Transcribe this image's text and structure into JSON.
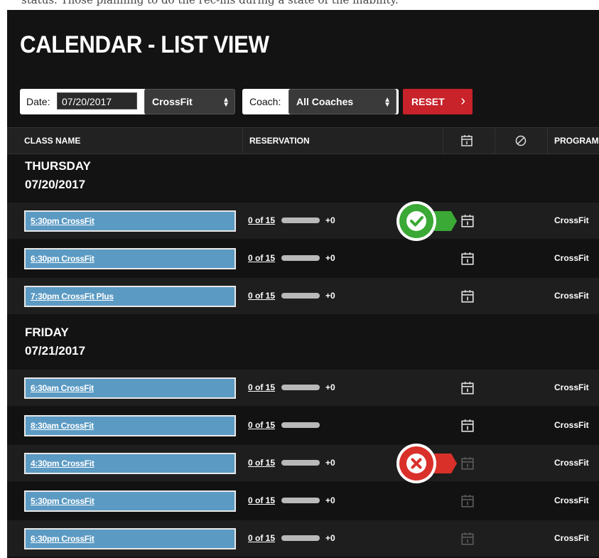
{
  "page": {
    "title": "CALENDAR - LIST VIEW",
    "top_caption": "status. Those planning to do the rec-ins during a state of the inability."
  },
  "filters": {
    "date_label": "Date:",
    "date_value": "07/20/2017",
    "program_value": "CrossFit",
    "coach_label": "Coach:",
    "coach_value": "All Coaches",
    "reset_label": "RESET"
  },
  "table": {
    "headers": {
      "class_name": "CLASS NAME",
      "reservation": "RESERVATION",
      "calendar_icon": "calendar-icon",
      "cancel_icon": "cancel-icon",
      "program": "PROGRAM"
    }
  },
  "days": [
    {
      "day": "THURSDAY",
      "date": "07/20/2017",
      "rows": [
        {
          "class": "5:30pm CrossFit",
          "reservation": "0 of 15",
          "waitlist": "+0",
          "program": "CrossFit"
        },
        {
          "class": "6:30pm CrossFit",
          "reservation": "0 of 15",
          "waitlist": "+0",
          "program": "CrossFit"
        },
        {
          "class": "7:30pm CrossFit Plus",
          "reservation": "0 of 15",
          "waitlist": "+0",
          "program": "CrossFit"
        }
      ]
    },
    {
      "day": "FRIDAY",
      "date": "07/21/2017",
      "rows": [
        {
          "class": "6:30am CrossFit",
          "reservation": "0 of 15",
          "waitlist": "+0",
          "program": "CrossFit"
        },
        {
          "class": "8:30am CrossFit",
          "reservation": "0 of 15",
          "waitlist": "",
          "program": "CrossFit"
        },
        {
          "class": "4:30pm CrossFit",
          "reservation": "0 of 15",
          "waitlist": "+0",
          "program": "CrossFit"
        },
        {
          "class": "5:30pm CrossFit",
          "reservation": "0 of 15",
          "waitlist": "+0",
          "program": "CrossFit"
        },
        {
          "class": "6:30pm CrossFit",
          "reservation": "0 of 15",
          "waitlist": "+0",
          "program": "CrossFit"
        }
      ]
    }
  ],
  "annotations": {
    "available_icon": "green-checkmark-icon",
    "unavailable_icon": "red-x-icon"
  },
  "colors": {
    "panel_bg": "#131313",
    "class_button": "#5b9ac3",
    "reset_button": "#c8222a",
    "check_green": "#3aa935",
    "x_red": "#d9302a"
  }
}
